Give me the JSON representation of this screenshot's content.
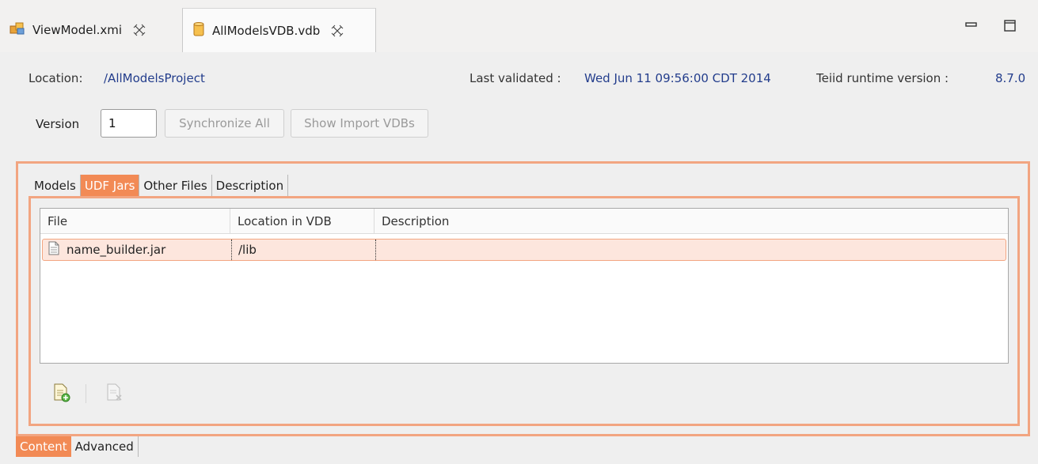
{
  "editor_tabs": [
    {
      "label": "ViewModel.xmi",
      "icon": "model-icon",
      "active": false
    },
    {
      "label": "AllModelsVDB.vdb",
      "icon": "database-icon",
      "active": true
    }
  ],
  "header": {
    "location_label": "Location:",
    "location_value": "/AllModelsProject",
    "last_validated_label": "Last validated :",
    "last_validated_value": "Wed Jun 11 09:56:00 CDT 2014",
    "runtime_label": "Teiid runtime version :",
    "runtime_value": "8.7.0"
  },
  "version": {
    "label": "Version",
    "value": "1"
  },
  "buttons": {
    "synchronize": "Synchronize All",
    "show_import": "Show Import VDBs"
  },
  "inner_tabs": [
    {
      "label": "Models",
      "active": false
    },
    {
      "label": "UDF Jars",
      "active": true
    },
    {
      "label": "Other Files",
      "active": false
    },
    {
      "label": "Description",
      "active": false
    }
  ],
  "table": {
    "columns": [
      "File",
      "Location in VDB",
      "Description"
    ],
    "rows": [
      {
        "file": "name_builder.jar",
        "location": "/lib",
        "description": ""
      }
    ]
  },
  "bottom_tabs": [
    {
      "label": "Content",
      "active": true
    },
    {
      "label": "Advanced",
      "active": false
    }
  ],
  "colors": {
    "accent": "#f28a55",
    "frame": "#f2a581",
    "link_text": "#233d8c",
    "selected_row": "#fde6dd"
  }
}
